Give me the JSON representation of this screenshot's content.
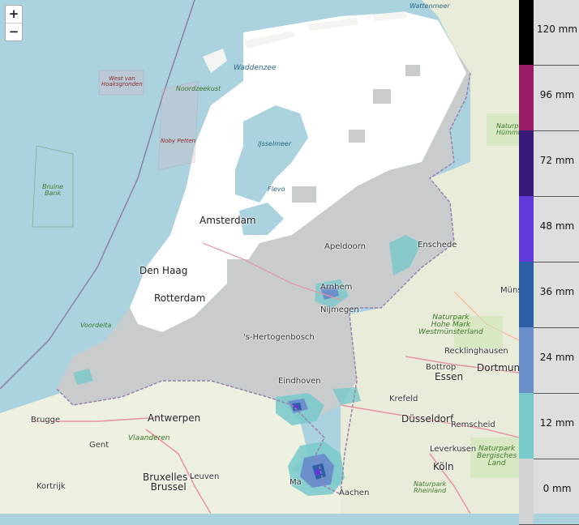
{
  "zoom": {
    "in_label": "+",
    "out_label": "−"
  },
  "legend": {
    "items": [
      {
        "label": "120 mm",
        "color": "#000000"
      },
      {
        "label": "96 mm",
        "color": "#9b1d6a"
      },
      {
        "label": "72 mm",
        "color": "#3a1a78"
      },
      {
        "label": "48 mm",
        "color": "#6338d8"
      },
      {
        "label": "36 mm",
        "color": "#2c5fa6"
      },
      {
        "label": "24 mm",
        "color": "#6a8fcb"
      },
      {
        "label": "12 mm",
        "color": "#78c9cb"
      },
      {
        "label": "0 mm",
        "color": "#d0d2d3"
      }
    ]
  },
  "labels": {
    "wattenmeer": "Wattenmeer",
    "waddenzee": "Waddenzee",
    "noordzeekust": "Noordzeekust",
    "west_van_1": "West van",
    "west_van_2": "Hoaksgronden",
    "noby_petten": "Noby Petten",
    "bruine_1": "Bruine",
    "bruine_2": "Bank",
    "ijsselmeer": "IJsselmeer",
    "flevo": "Flevo",
    "amsterdam": "Amsterdam",
    "den_haag": "Den Haag",
    "rotterdam": "Rotterdam",
    "voordelta": "Voordelta",
    "brugge": "Brugge",
    "antwerpen": "Antwerpen",
    "gent": "Gent",
    "bruxelles_1": "Bruxelles -",
    "bruxelles_2": "Brussel",
    "kortrijk": "Kortrijk",
    "leuven": "Leuven",
    "vlaanderen": "Vlaanderen",
    "eindhoven": "Eindhoven",
    "nijmegen": "Nijmegen",
    "arnhem": "Arnhem",
    "enschede": "Enschede",
    "apeldoorn": "Apeldoorn",
    "s_hertogenbosch": "'s-Hertogenbosch",
    "krefeld": "Krefeld",
    "dusseldorf": "Düsseldorf",
    "essen": "Essen",
    "bottrop": "Bottrop",
    "dortmund": "Dortmund",
    "recklinghausen": "Recklinghausen",
    "munster": "Münster",
    "remscheid": "Remscheid",
    "leverkusen": "Leverkusen",
    "koln": "Köln",
    "aachen": "Aachen",
    "maastricht": "Ma",
    "naturpark_hm_1": "Naturpark",
    "naturpark_hm_2": "Hohe Mark",
    "naturpark_hm_3": "Westmünsterland",
    "naturpark_bl_1": "Naturpark",
    "naturpark_bl_2": "Bergisches",
    "naturpark_bl_3": "Land",
    "naturpark_rh_1": "Naturpark",
    "naturpark_rh_2": "Rheinland",
    "naturpark_tr_1": "Naturpark",
    "naturpark_tr_2": "Hümmli"
  }
}
